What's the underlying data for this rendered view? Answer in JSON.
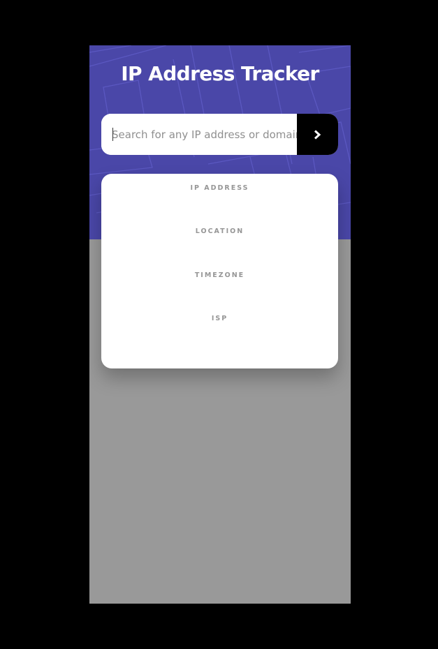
{
  "header": {
    "title": "IP Address Tracker"
  },
  "search": {
    "placeholder": "Search for any IP address or domain",
    "value": "",
    "submit_icon": "chevron-right-icon"
  },
  "info": {
    "items": [
      {
        "label": "IP ADDRESS",
        "value": ""
      },
      {
        "label": "LOCATION",
        "value": ""
      },
      {
        "label": "TIMEZONE",
        "value": ""
      },
      {
        "label": "ISP",
        "value": ""
      }
    ]
  },
  "colors": {
    "header_bg": "#4a47a8",
    "page_bg": "#000000",
    "map_bg": "#999999",
    "button_bg": "#000000",
    "card_bg": "#ffffff",
    "label_color": "#969696"
  }
}
